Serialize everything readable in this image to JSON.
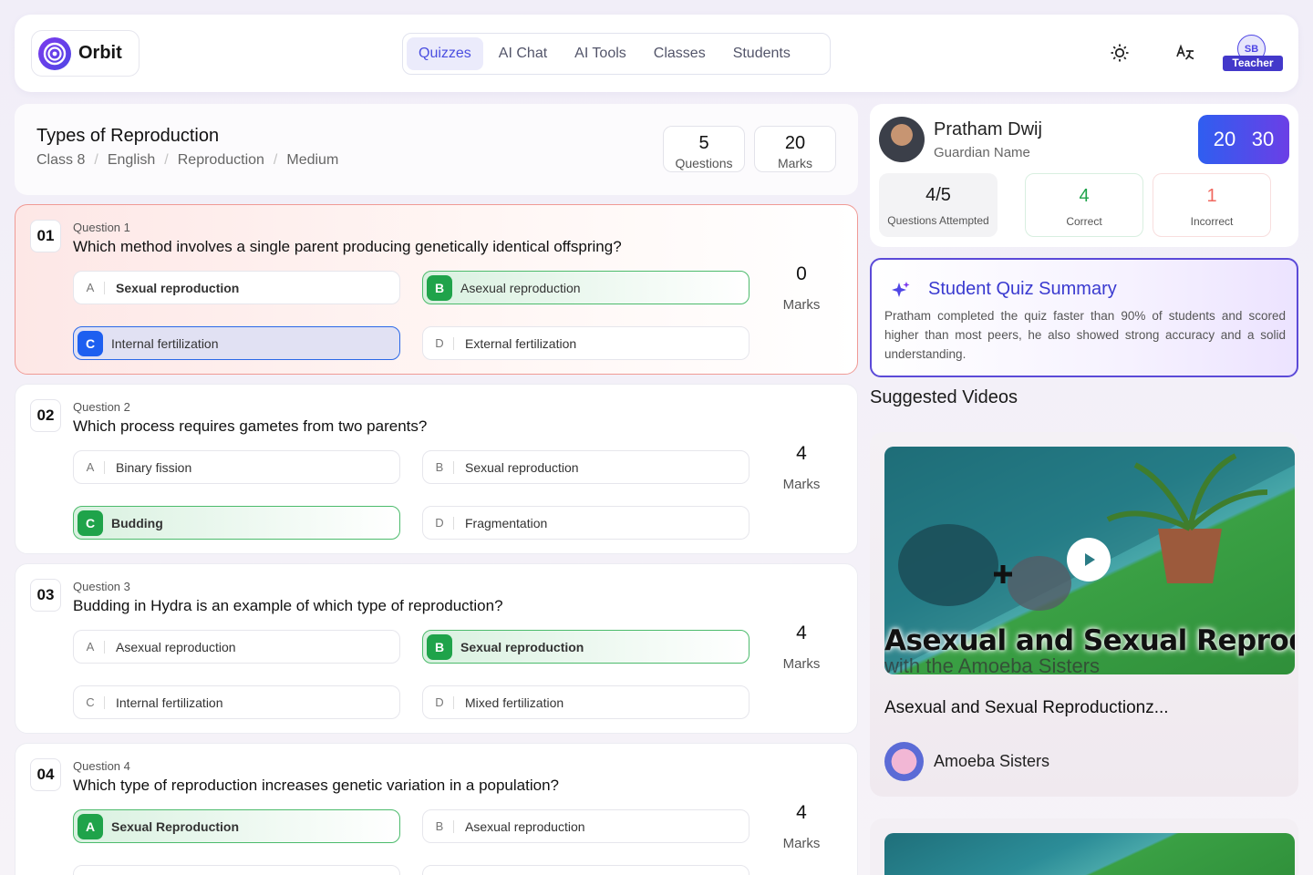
{
  "app": {
    "name": "Orbit"
  },
  "nav": {
    "tabs": [
      "Quizzes",
      "AI Chat",
      "AI Tools",
      "Classes",
      "Students"
    ],
    "active": 0
  },
  "user": {
    "initials": "SB",
    "role": "Teacher"
  },
  "quiz": {
    "title": "Types of Reproduction",
    "breadcrumbs": [
      "Class 8",
      "English",
      "Reproduction",
      "Medium"
    ],
    "stats": [
      {
        "value": "5",
        "label": "Questions"
      },
      {
        "value": "20",
        "label": "Marks"
      }
    ]
  },
  "questions": [
    {
      "number": "01",
      "label": "Question 1",
      "text": "Which method involves a single parent producing genetically identical offspring?",
      "options": [
        {
          "letter": "A",
          "text": "Sexual reproduction"
        },
        {
          "letter": "B",
          "text": "Asexual reproduction"
        },
        {
          "letter": "C",
          "text": "Internal fertilization"
        },
        {
          "letter": "D",
          "text": "External fertilization"
        }
      ],
      "marks": "0",
      "marks_label": "Marks"
    },
    {
      "number": "02",
      "label": "Question 2",
      "text": "Which process requires gametes from two parents?",
      "options": [
        {
          "letter": "A",
          "text": "Binary fission"
        },
        {
          "letter": "B",
          "text": "Sexual reproduction"
        },
        {
          "letter": "C",
          "text": "Budding"
        },
        {
          "letter": "D",
          "text": "Fragmentation"
        }
      ],
      "marks": "4",
      "marks_label": "Marks"
    },
    {
      "number": "03",
      "label": "Question 3",
      "text": "Budding in Hydra is an example of which type of reproduction?",
      "options": [
        {
          "letter": "A",
          "text": "Asexual reproduction"
        },
        {
          "letter": "B",
          "text": "Sexual reproduction"
        },
        {
          "letter": "C",
          "text": "Internal fertilization"
        },
        {
          "letter": "D",
          "text": "Mixed fertilization"
        }
      ],
      "marks": "4",
      "marks_label": "Marks"
    },
    {
      "number": "04",
      "label": "Question 4",
      "text": "Which type of reproduction increases genetic variation in a population?",
      "options": [
        {
          "letter": "A",
          "text": "Sexual Reproduction"
        },
        {
          "letter": "B",
          "text": "Asexual reproduction"
        }
      ],
      "marks": "4",
      "marks_label": "Marks"
    }
  ],
  "student": {
    "name": "Pratham Dwij",
    "guardian": "Guardian Name",
    "score": "20",
    "total": "30",
    "stats": [
      {
        "value": "4/5",
        "label": "Questions Attempted"
      },
      {
        "value": "4",
        "label": "Correct"
      },
      {
        "value": "1",
        "label": "Incorrect"
      }
    ]
  },
  "summary": {
    "title": "Student Quiz Summary",
    "text": "Pratham completed the quiz faster than 90% of students and scored higher than most peers, he also showed strong accuracy and a solid understanding."
  },
  "videos": {
    "title": "Suggested Videos",
    "items": [
      {
        "thumb_title": "Asexual and Sexual Reproduction",
        "thumb_subtitle": "with the Amoeba Sisters",
        "title": "Asexual and Sexual Reproductionz...",
        "channel": "Amoeba Sisters"
      }
    ]
  },
  "colors": {
    "accent": "#4a4ee0",
    "correct": "#1fa34a",
    "selected": "#1d5ff0",
    "incorrect": "#f0685f"
  }
}
